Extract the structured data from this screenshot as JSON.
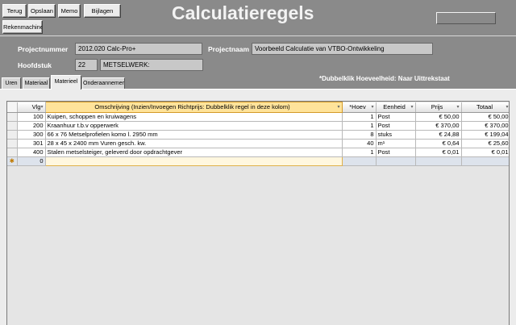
{
  "toolbar": {
    "terug": "Terug",
    "opslaan": "Opslaan",
    "memo": "Memo",
    "bijlagen": "Bijlagen",
    "rekenmachine": "Rekenmachine"
  },
  "page_title": "Calculatieregels",
  "header": {
    "projectnummer_label": "Projectnummer",
    "projectnummer_value": "2012.020 Calc-Pro+",
    "projectnaam_label": "Projectnaam",
    "projectnaam_value": "Voorbeeld Calculatie van VTBO-Ontwikkeling",
    "hoofdstuk_label": "Hoofdstuk",
    "hoofdstuk_code": "22",
    "hoofdstuk_name": "METSELWERK:"
  },
  "hint": "*Dubbelklik Hoeveelheid: Naar Uittrekstaat",
  "tabs": [
    {
      "label": "Uren"
    },
    {
      "label": "Materiaal"
    },
    {
      "label": "Materieel",
      "active": true
    },
    {
      "label": "Onderaannemer"
    }
  ],
  "grid": {
    "columns": {
      "vlg": "Vlg",
      "omschrijving": "Omschrijving (Inzien/Invoegen Richtprijs: Dubbelklik regel in deze kolom)",
      "hoev": "*Hoev",
      "eenheid": "Eenheid",
      "prijs": "Prijs",
      "totaal": "Totaal"
    },
    "rows": [
      {
        "vlg": "100",
        "omschrijving": "Kuipen, schoppen en kruiwagens",
        "hoev": "1",
        "eenheid": "Post",
        "prijs": "€ 50,00",
        "totaal": "€ 50,00"
      },
      {
        "vlg": "200",
        "omschrijving": "Kraanhuur t.b.v opperwerk",
        "hoev": "1",
        "eenheid": "Post",
        "prijs": "€ 370,00",
        "totaal": "€ 370,00"
      },
      {
        "vlg": "300",
        "omschrijving": "66 x 76 Metselprofielen komo l. 2950 mm",
        "hoev": "8",
        "eenheid": "stuks",
        "prijs": "€ 24,88",
        "totaal": "€ 199,04"
      },
      {
        "vlg": "301",
        "omschrijving": "28 x  45 x 2400 mm Vuren gesch. kw.",
        "hoev": "40",
        "eenheid": "m¹",
        "prijs": "€ 0,64",
        "totaal": "€ 25,60"
      },
      {
        "vlg": "400",
        "omschrijving": "Stalen metselsteiger, geleverd door opdrachtgever",
        "hoev": "1",
        "eenheid": "Post",
        "prijs": "€ 0,01",
        "totaal": "€ 0,01"
      }
    ],
    "new_row": {
      "marker": "✱",
      "vlg": "0"
    }
  },
  "colors": {
    "background": "#8a8a8a",
    "panel": "#ececec",
    "header_highlight": "#ffe39a"
  },
  "icons": {
    "new-row": "asterisk-icon",
    "sort": "dropdown-arrow-icon"
  }
}
